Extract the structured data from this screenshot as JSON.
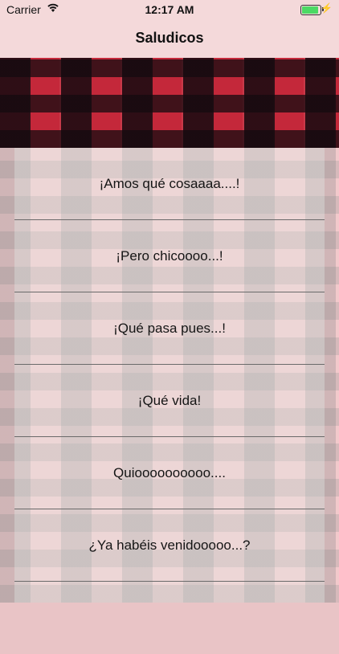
{
  "status_bar": {
    "carrier": "Carrier",
    "time": "12:17 AM",
    "battery_level": 1.0,
    "battery_color": "#4cd964",
    "icons": [
      "wifi-icon",
      "battery-icon",
      "charging-bolt-icon"
    ]
  },
  "nav": {
    "title": "Saludicos"
  },
  "banner": {
    "pattern": "red-black-plaid",
    "colors": [
      "#c4283a",
      "#140a0f"
    ]
  },
  "list": {
    "items": [
      "¡Amos qué cosaaaa....!",
      "¡Pero chicoooo...!",
      "¡Qué pasa pues...!",
      "¡Qué vida!",
      "Quioooooooooo....",
      "¿Ya habéis venidooooo...?",
      ""
    ]
  }
}
